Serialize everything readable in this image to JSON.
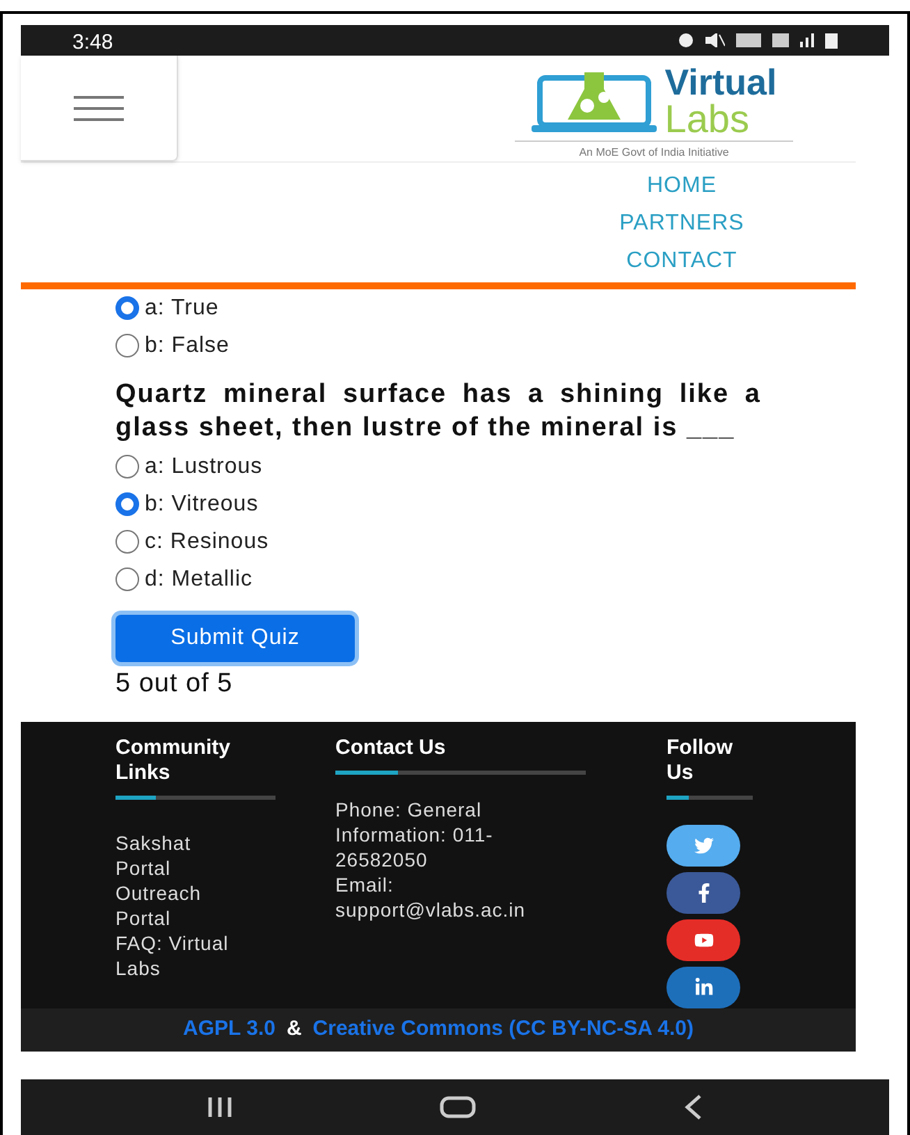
{
  "status_bar": {
    "time": "3:48"
  },
  "header": {
    "logo": {
      "word1": "Virtual",
      "word2": "Labs",
      "tagline": "An MoE Govt of India Initiative"
    },
    "nav": [
      {
        "label": "HOME"
      },
      {
        "label": "PARTNERS"
      },
      {
        "label": "CONTACT"
      }
    ]
  },
  "quiz": {
    "previous_options": [
      {
        "label": "a: True",
        "selected": true
      },
      {
        "label": "b: False",
        "selected": false
      }
    ],
    "question": "Quartz mineral surface has a shining like a glass sheet, then lustre of the mineral is ___",
    "options": [
      {
        "label": "a: Lustrous",
        "selected": false
      },
      {
        "label": "b: Vitreous",
        "selected": true
      },
      {
        "label": "c: Resinous",
        "selected": false
      },
      {
        "label": "d: Metallic",
        "selected": false
      }
    ],
    "submit": "Submit Quiz",
    "score": "5 out of 5"
  },
  "footer": {
    "community": {
      "title": "Community Links",
      "links": [
        "Sakshat Portal",
        "Outreach Portal",
        "FAQ: Virtual Labs"
      ]
    },
    "contact": {
      "title": "Contact Us",
      "lines": [
        "Phone: General Information: 011-26582050",
        "Email: support@vlabs.ac.in"
      ]
    },
    "follow": {
      "title": "Follow Us",
      "socials": [
        {
          "kind": "twitter"
        },
        {
          "kind": "facebook"
        },
        {
          "kind": "youtube"
        },
        {
          "kind": "linkedin"
        }
      ]
    },
    "license": {
      "left": "AGPL 3.0",
      "separator": "&",
      "right": "Creative Commons (CC BY-NC-SA 4.0)"
    }
  }
}
